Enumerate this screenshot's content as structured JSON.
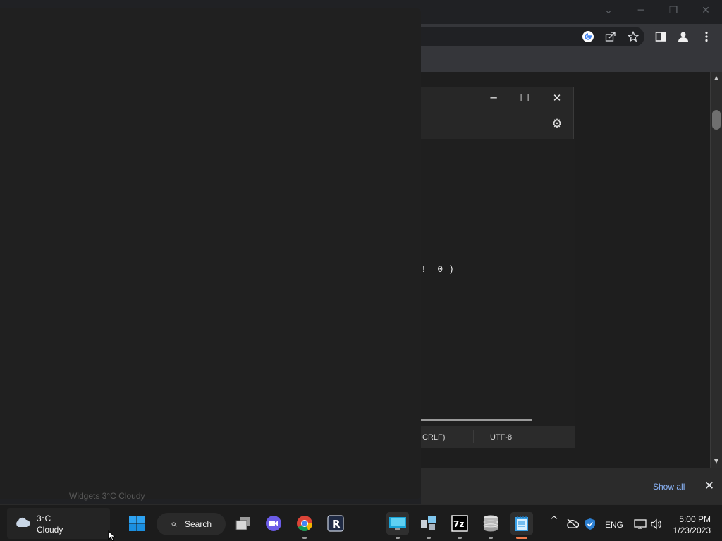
{
  "chrome": {
    "window_controls": {
      "minimize": "─",
      "restore": "❐",
      "close": "✕",
      "dropdown": "⌄"
    },
    "toolbar_icons": [
      "google-icon",
      "share-icon",
      "bookmark-star-icon",
      "side-panel-icon",
      "profile-icon",
      "more-icon"
    ]
  },
  "notepad": {
    "controls": {
      "minimize": "─",
      "maximize": "☐",
      "close": "✕"
    },
    "settings_icon": "⚙",
    "editor_line": "!= 0 )",
    "status": {
      "line_ending": "CRLF)",
      "encoding": "UTF-8"
    }
  },
  "widgets": {
    "tooltip": "Widgets 3°C Cloudy"
  },
  "download_bar": {
    "show_all": "Show all",
    "close": "✕"
  },
  "taskbar": {
    "weather": {
      "temp": "3°C",
      "desc": "Cloudy"
    },
    "search_label": "Search",
    "tray": {
      "language": "ENG",
      "chevron": "^"
    },
    "clock": {
      "time": "5:00 PM",
      "date": "1/23/2023"
    }
  },
  "colors": {
    "accent_blue": "#0078d4",
    "link_blue": "#8ab4f8",
    "active_indicator": "#f07a4a"
  }
}
